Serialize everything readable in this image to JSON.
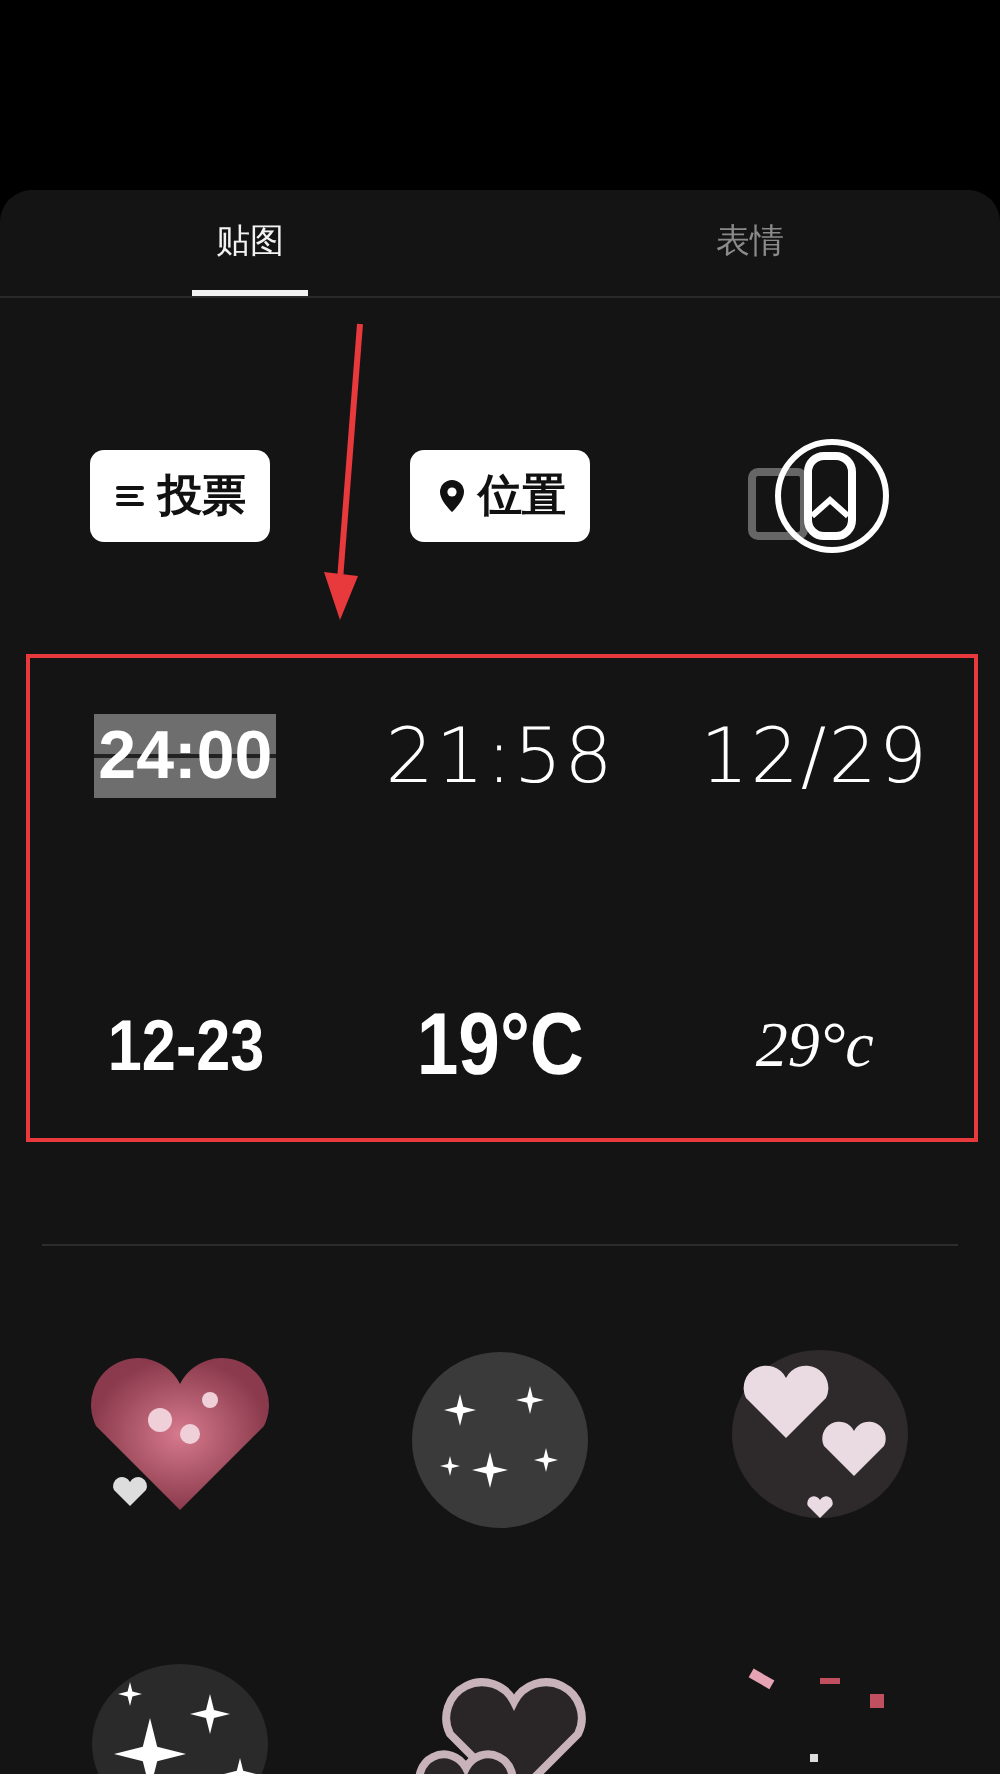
{
  "tabs": [
    {
      "label": "贴图",
      "selected": true
    },
    {
      "label": "表情",
      "selected": false
    }
  ],
  "quick_stickers": [
    {
      "kind": "poll",
      "label": "投票"
    },
    {
      "kind": "location",
      "label": "位置"
    },
    {
      "kind": "photo"
    }
  ],
  "text_stickers": [
    {
      "kind": "flip-clock",
      "text": "24:00"
    },
    {
      "kind": "thin",
      "text": "21:58"
    },
    {
      "kind": "thin",
      "text": "12/29"
    },
    {
      "kind": "condensed",
      "text": "12-23"
    },
    {
      "kind": "bold",
      "text": "19°C"
    },
    {
      "kind": "handwritten",
      "text": "29°c"
    }
  ],
  "image_stickers": [
    {
      "kind": "glitter-heart"
    },
    {
      "kind": "star-cluster"
    },
    {
      "kind": "glowing-hearts"
    },
    {
      "kind": "sparkles"
    },
    {
      "kind": "bubble-hearts"
    },
    {
      "kind": "confetti"
    }
  ],
  "annotation": {
    "highlight_frame": true,
    "pointer_arrow": true
  }
}
